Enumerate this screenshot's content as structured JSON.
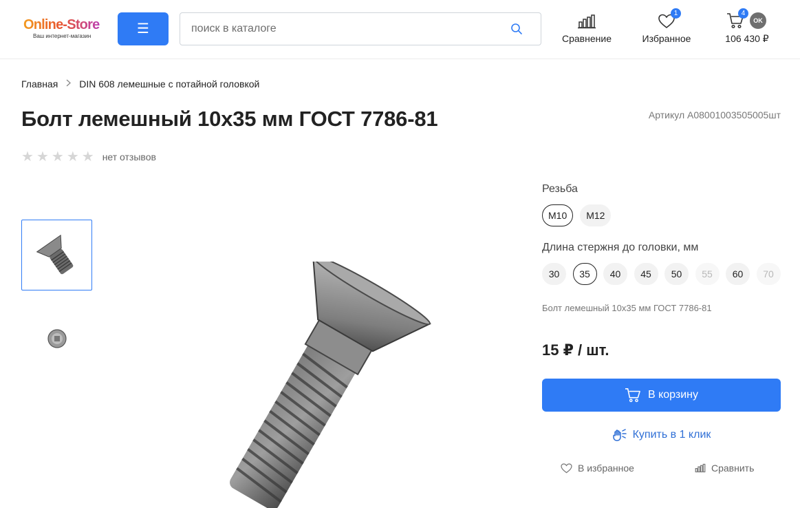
{
  "header": {
    "logo_main": "Online-Store",
    "logo_sub": "Ваш интернет-магазин",
    "menu_icon": "☰",
    "search_placeholder": "поиск в каталоге",
    "compare_label": "Сравнение",
    "favorites_label": "Избранное",
    "favorites_count": "1",
    "cart_count": "4",
    "cart_total": "106 430 ₽",
    "user_badge": "OK",
    "accent_color": "#2f7bf5"
  },
  "breadcrumb": {
    "home": "Главная",
    "category": "DIN 608 лемешные с потайной головкой"
  },
  "product": {
    "title": "Болт лемешный 10х35 мм ГОСТ 7786-81",
    "sku": "Артикул A08001003505005шт",
    "reviews": "нет отзывов",
    "rating": 0,
    "rating_max": 5,
    "description": "Болт лемешный 10х35 мм ГОСТ 7786-81",
    "price": "15 ₽ / шт."
  },
  "options": {
    "thread_label": "Резьба",
    "thread_values": [
      "M10",
      "M12"
    ],
    "thread_selected": "M10",
    "length_label": "Длина стержня до головки, мм",
    "length_values": [
      "30",
      "35",
      "40",
      "45",
      "50",
      "55",
      "60",
      "70"
    ],
    "length_selected": "35",
    "length_disabled": [
      "55",
      "70"
    ]
  },
  "actions": {
    "add_to_cart": "В корзину",
    "buy_one_click": "Купить в 1 клик",
    "to_favorites": "В избранное",
    "compare": "Сравнить"
  }
}
